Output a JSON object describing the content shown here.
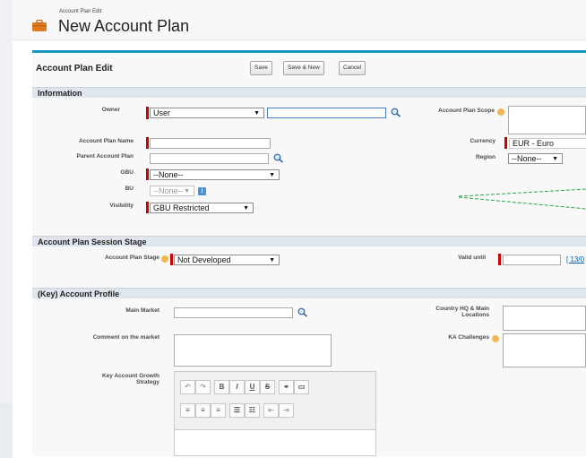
{
  "header": {
    "breadcrumb": "Account Plan Edit",
    "title": "New Account Plan"
  },
  "toolbar": {
    "title": "Account Plan Edit",
    "save": "Save",
    "save_new": "Save & New",
    "cancel": "Cancel"
  },
  "sections": {
    "information": "Information",
    "session_stage": "Account Plan Session Stage",
    "profile": "(Key) Account Profile"
  },
  "information": {
    "owner_label": "Owner",
    "owner_type": "User",
    "owner_value": "",
    "scope_label": "Account Plan Scope",
    "name_label": "Account Plan Name",
    "parent_label": "Parent Account Plan",
    "currency_label": "Currency",
    "currency_value": "EUR - Euro",
    "region_label": "Region",
    "region_value": "--None--",
    "gbu_label": "GBU",
    "gbu_value": "--None--",
    "bu_label": "BU",
    "bu_value": "--None--",
    "visibility_label": "Visibility",
    "visibility_value": "GBU Restricted"
  },
  "stage": {
    "stage_label": "Account Plan Stage",
    "stage_value": "Not Developed",
    "valid_label": "Valid until",
    "valid_link": "[ 13/0"
  },
  "profile": {
    "main_market_label": "Main Market",
    "comment_label": "Comment on the market",
    "growth_label_1": "Key Account Growth",
    "growth_label_2": "Strategy",
    "country_label_1": "Country HQ & Main",
    "country_label_2": "Locations",
    "ka_label": "KA Challenges"
  },
  "rte_buttons": {
    "bold": "B",
    "italic": "I",
    "underline": "U",
    "strike": "S"
  },
  "icons": [
    "account-plan-icon",
    "lookup-icon",
    "info-icon",
    "undo-icon",
    "redo-icon",
    "link-icon",
    "image-icon"
  ],
  "colors": {
    "accent": "#1797c0",
    "required": "#cc0000",
    "section": "#dfe5ec"
  }
}
